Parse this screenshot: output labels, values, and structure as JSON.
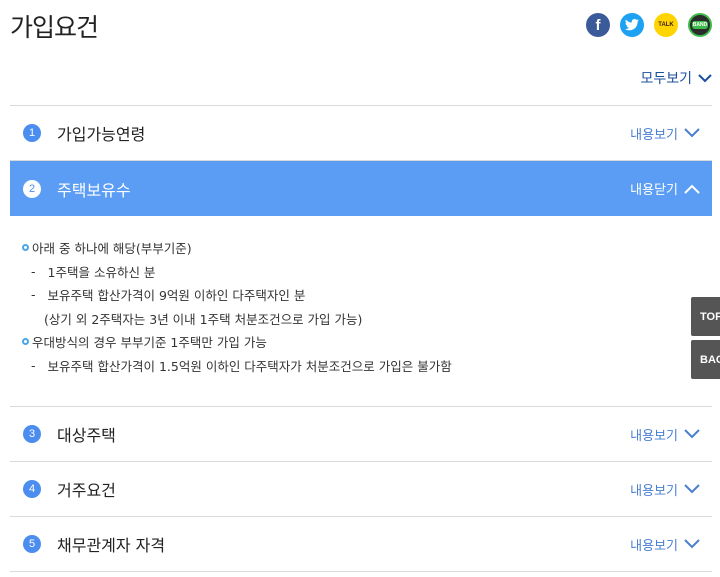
{
  "page": {
    "title": "가입요건"
  },
  "share": {
    "facebook": "f",
    "kakaotalk": "TALK",
    "band": "BAND"
  },
  "expand_all_label": "모두보기",
  "sections": [
    {
      "number": "1",
      "title": "가입가능연령",
      "toggle_label": "내용보기"
    },
    {
      "number": "2",
      "title": "주택보유수",
      "toggle_label": "내용닫기"
    },
    {
      "number": "3",
      "title": "대상주택",
      "toggle_label": "내용보기"
    },
    {
      "number": "4",
      "title": "거주요건",
      "toggle_label": "내용보기"
    },
    {
      "number": "5",
      "title": "채무관계자 자격",
      "toggle_label": "내용보기"
    }
  ],
  "open_section_content": {
    "bullet_1": "아래 중 하나에 해당(부부기준)",
    "item_1": "1주택을 소유하신 분",
    "item_2": "보유주택 합산가격이 9억원 이하인 다주택자인 분",
    "item_2_note": "(상기 외 2주택자는 3년 이내 1주택 처분조건으로 가입 가능)",
    "bullet_2": "우대방식의 경우 부부기준 1주택만 가입 가능",
    "item_3": "보유주택 합산가격이 1.5억원 이하인 다주택자가 처분조건으로 가입은 불가함",
    "dash": "-"
  },
  "side_buttons": {
    "top": "TOP",
    "back": "BACK"
  },
  "colors": {
    "accent": "#5b9df4",
    "link": "#1a4fa0",
    "number_badge": "#4c8ef0"
  }
}
